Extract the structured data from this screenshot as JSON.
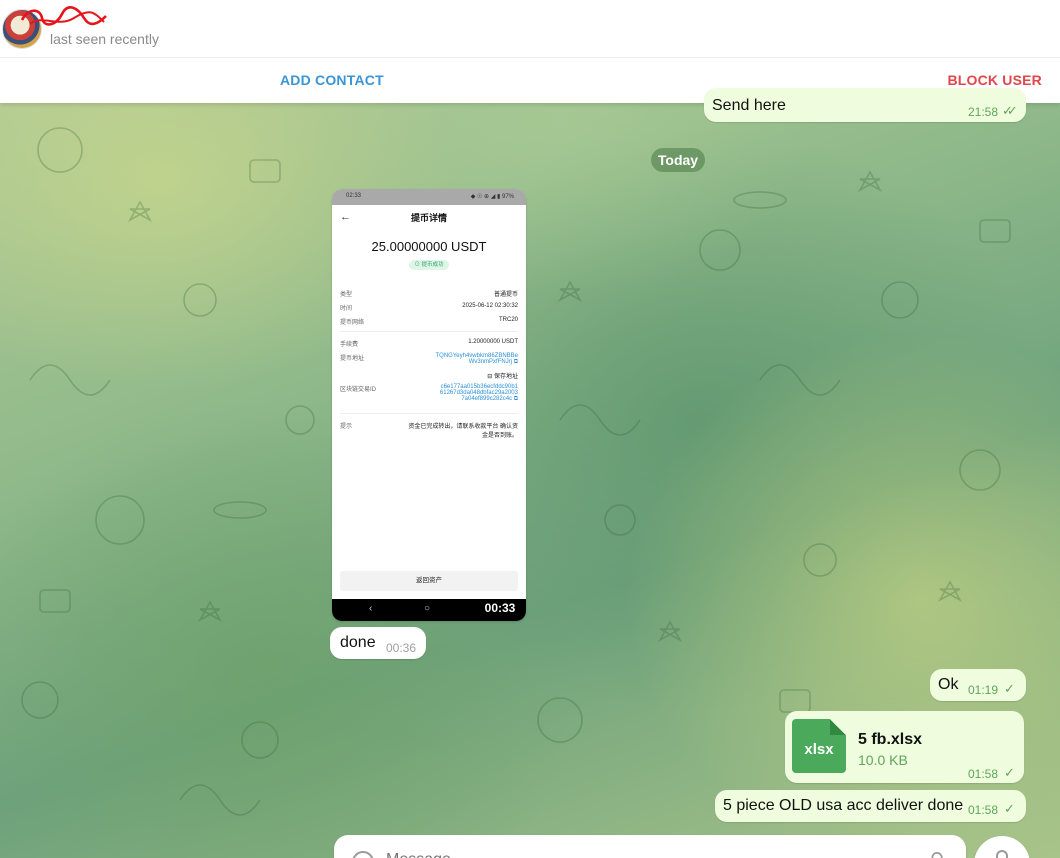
{
  "header": {
    "status": "last seen recently",
    "add_contact": "ADD CONTACT",
    "block_user": "BLOCK USER"
  },
  "messages": {
    "prev": {
      "text": "Send here",
      "time": "21:58"
    },
    "date_separator": "Today",
    "screenshot": {
      "status_time": "02:33",
      "status_right": "◆ ☉ ⊕ ◢ ▮ 97%",
      "title": "提币详情",
      "amount": "25.00000000 USDT",
      "badge": "⊙ 提币成功",
      "rows": [
        {
          "label": "类型",
          "value": "普通提币"
        },
        {
          "label": "时间",
          "value": "2025-06-12 02:30:32"
        },
        {
          "label": "提币网络",
          "value": "TRC20"
        },
        {
          "label": "手续费",
          "value": "1.20000000 USDT"
        },
        {
          "label": "提币地址",
          "value": "TQNGYeyh4vwbkm86ZBNBBe Wv3nmPxfFNJrj ⧉"
        },
        {
          "label": "",
          "value": "⊟ 保存地址"
        },
        {
          "label": "区块链交易ID",
          "value": "c6e177aa015b36ecfddc90b1 61267d3da048dbfac29a2003 7a04ef899c282c4c ⧉"
        },
        {
          "label": "提示",
          "value": "资金已完成转出，请联系收款平台 确认资金是否到账。"
        }
      ],
      "button": "返回资产",
      "duration": "00:33"
    },
    "done": {
      "text": "done",
      "time": "00:36"
    },
    "ok": {
      "text": "Ok",
      "time": "01:19"
    },
    "file": {
      "ext": "xlsx",
      "name": "5 fb.xlsx",
      "size": "10.0 KB",
      "time": "01:58"
    },
    "deliver": {
      "text": "5 piece OLD usa acc deliver done",
      "time": "01:58"
    }
  },
  "composer": {
    "placeholder": "Message"
  },
  "colors": {
    "accent": "#3a95d5",
    "danger": "#e0474a",
    "outgoing": "#effdde",
    "tick": "#5fa55a"
  }
}
